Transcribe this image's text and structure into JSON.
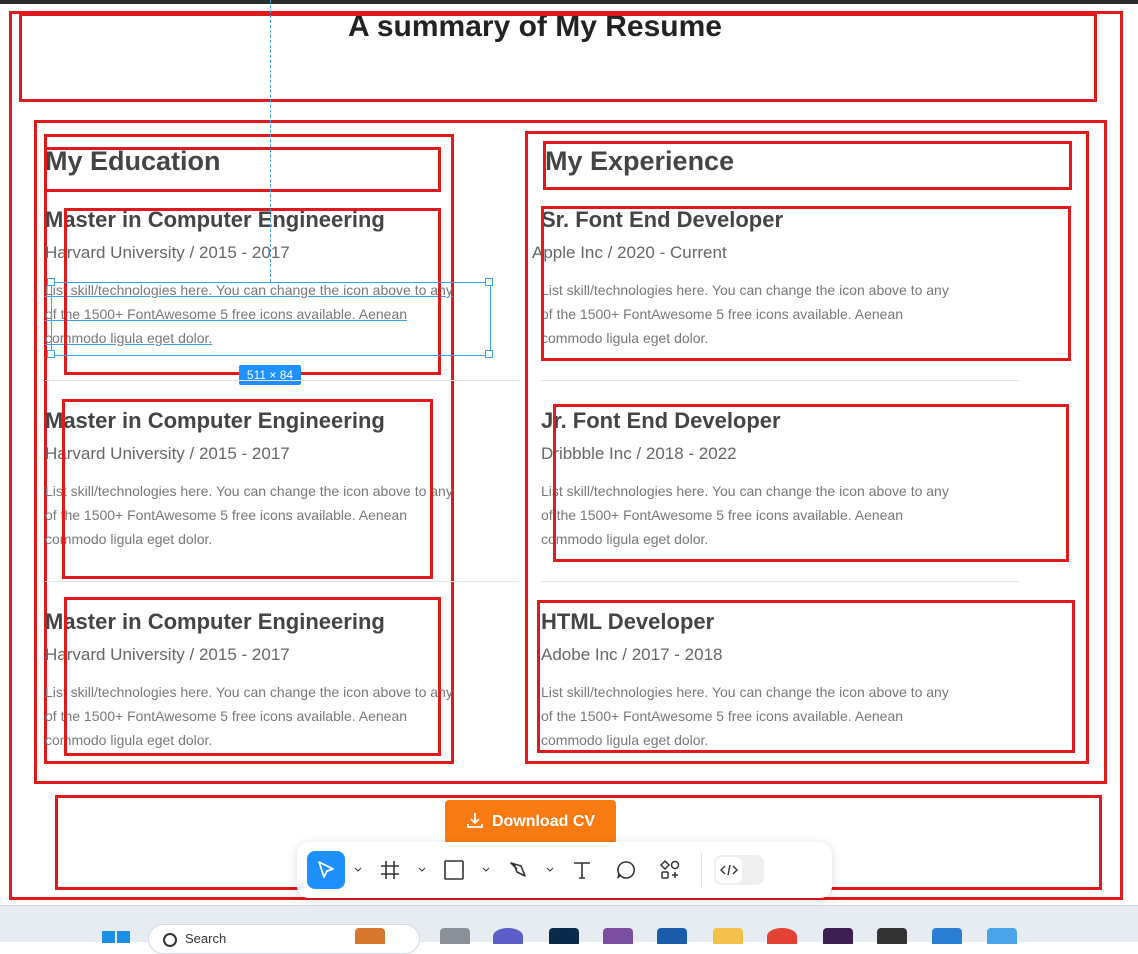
{
  "page": {
    "title": "A summary of My Resume"
  },
  "education": {
    "heading": "My Education",
    "entries": [
      {
        "title": "Master in Computer Engineering",
        "sub": "Harvard University / 2015 - 2017",
        "desc": "List skill/technologies here. You can change the icon above to any of the 1500+ FontAwesome 5 free icons available. Aenean commodo ligula eget dolor."
      },
      {
        "title": "Master in Computer Engineering",
        "sub": "Harvard University / 2015 - 2017",
        "desc": "List skill/technologies here. You can change the icon above to any of the 1500+ FontAwesome 5 free icons available. Aenean commodo ligula eget dolor."
      },
      {
        "title": "Master in Computer Engineering",
        "sub": "Harvard University / 2015 - 2017",
        "desc": "List skill/technologies here. You can change the icon above to any of the 1500+ FontAwesome 5 free icons available. Aenean commodo ligula eget dolor."
      }
    ]
  },
  "experience": {
    "heading": "My Experience",
    "entries": [
      {
        "title": "Sr. Font End Developer",
        "sub": "Apple Inc / 2020 - Current",
        "desc": "List skill/technologies here. You can change the icon above to any of the 1500+ FontAwesome 5 free icons available. Aenean commodo ligula eget dolor."
      },
      {
        "title": "Jr. Font End Developer",
        "sub": "Dribbble Inc / 2018 - 2022",
        "desc": "List skill/technologies here. You can change the icon above to any of the 1500+ FontAwesome 5 free icons available. Aenean commodo ligula eget dolor."
      },
      {
        "title": "HTML Developer",
        "sub": "Adobe Inc / 2017 - 2018",
        "desc": "List skill/technologies here. You can change the icon above to any of the 1500+ FontAwesome 5 free icons available. Aenean commodo ligula eget dolor."
      }
    ]
  },
  "selection": {
    "size_label": "511 × 84"
  },
  "cta": {
    "download_label": "Download CV"
  },
  "toolbar": {
    "tools": [
      "move-tool",
      "frame-tool",
      "shape-tool",
      "pen-tool",
      "text-tool",
      "comment-tool",
      "components-tool",
      "dev-mode-toggle"
    ]
  },
  "taskbar": {
    "search_placeholder": "Search"
  },
  "colors": {
    "annotation_red": "#e0191c",
    "accent_orange": "#fa7a12",
    "selection_blue": "#1e90ff"
  }
}
